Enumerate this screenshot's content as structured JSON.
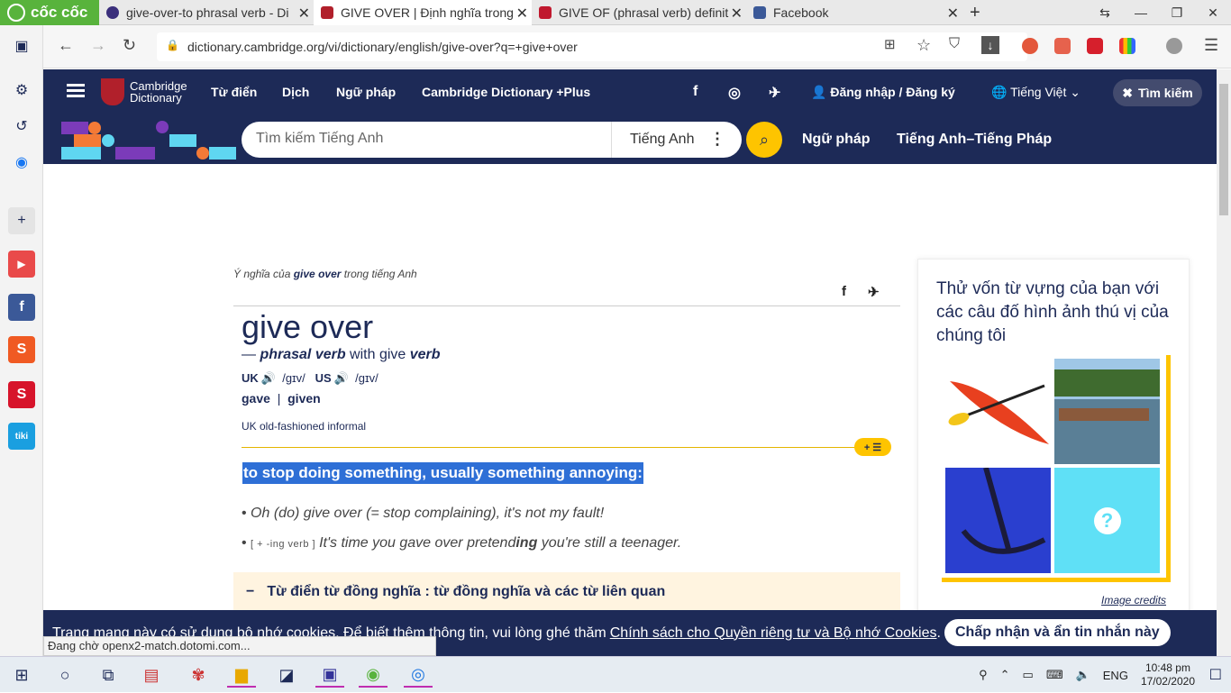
{
  "browser": {
    "brand": "cốc cốc",
    "tabs": [
      {
        "title": "give-over-to phrasal verb - Di",
        "color": "#3b2f7c"
      },
      {
        "title": "GIVE OVER | Định nghĩa trong",
        "color": "#b1202b"
      },
      {
        "title": "GIVE OF (phrasal verb) definit",
        "color": "#c0182e"
      },
      {
        "title": "Facebook",
        "color": "#3b5998"
      }
    ],
    "url": "dictionary.cambridge.org/vi/dictionary/english/give-over?q=+give+over",
    "status": "Đang chờ openx2-match.dotomi.com..."
  },
  "site": {
    "logo_line1": "Cambridge",
    "logo_line2": "Dictionary",
    "nav": [
      "Từ điển",
      "Dịch",
      "Ngữ pháp",
      "Cambridge Dictionary +Plus"
    ],
    "login": "Đăng nhập / Đăng ký",
    "language": "Tiếng Việt",
    "search_top": "Tìm kiếm",
    "search_placeholder": "Tìm kiếm Tiếng Anh",
    "search_lang": "Tiếng Anh",
    "sub_links": [
      "Ngữ pháp",
      "Tiếng Anh–Tiếng Pháp"
    ]
  },
  "entry": {
    "breadcrumb_pre": "Ý nghĩa của ",
    "breadcrumb_word": "give over",
    "breadcrumb_post": " trong tiếng Anh",
    "headword": "give over",
    "pos_dash": "— ",
    "pos": "phrasal verb",
    "pos_with": " with give ",
    "pos_verb": "verb",
    "uk_label": "UK",
    "uk_ipa": "/ɡɪv/",
    "us_label": "US",
    "us_ipa": "/ɡɪv/",
    "form1": "gave",
    "form_sep": "|",
    "form2": "given",
    "usage": "UK old-fashioned informal",
    "badge": "+ ☰",
    "definition": "to stop doing something, usually something annoying:",
    "example1": "Oh (do) give over (= stop complaining), it's not my fault!",
    "example2_gram": "[ + -ing verb ]",
    "example2_a": "It's time you gave over pretend",
    "example2_b": "ing",
    "example2_c": " you're still a teenager.",
    "thesaurus": "Từ điển từ đồng nghĩa : từ đồng nghĩa và các từ liên quan"
  },
  "quiz": {
    "title": "Thử vốn từ vựng của bạn với các câu đố hình ảnh thú vị của chúng tôi",
    "credits": "Image credits",
    "question_mark": "?"
  },
  "cookie": {
    "text": "Trang mạng này có sử dụng bộ nhớ cookies. Để biết thêm thông tin, vui lòng ghé thăm ",
    "link": "Chính sách cho Quyền riêng tư và Bộ nhớ Cookies",
    "end": ".",
    "button": "Chấp nhận và ẩn tin nhắn này"
  },
  "taskbar": {
    "lang": "ENG",
    "time": "10:48 pm",
    "date": "17/02/2020"
  }
}
